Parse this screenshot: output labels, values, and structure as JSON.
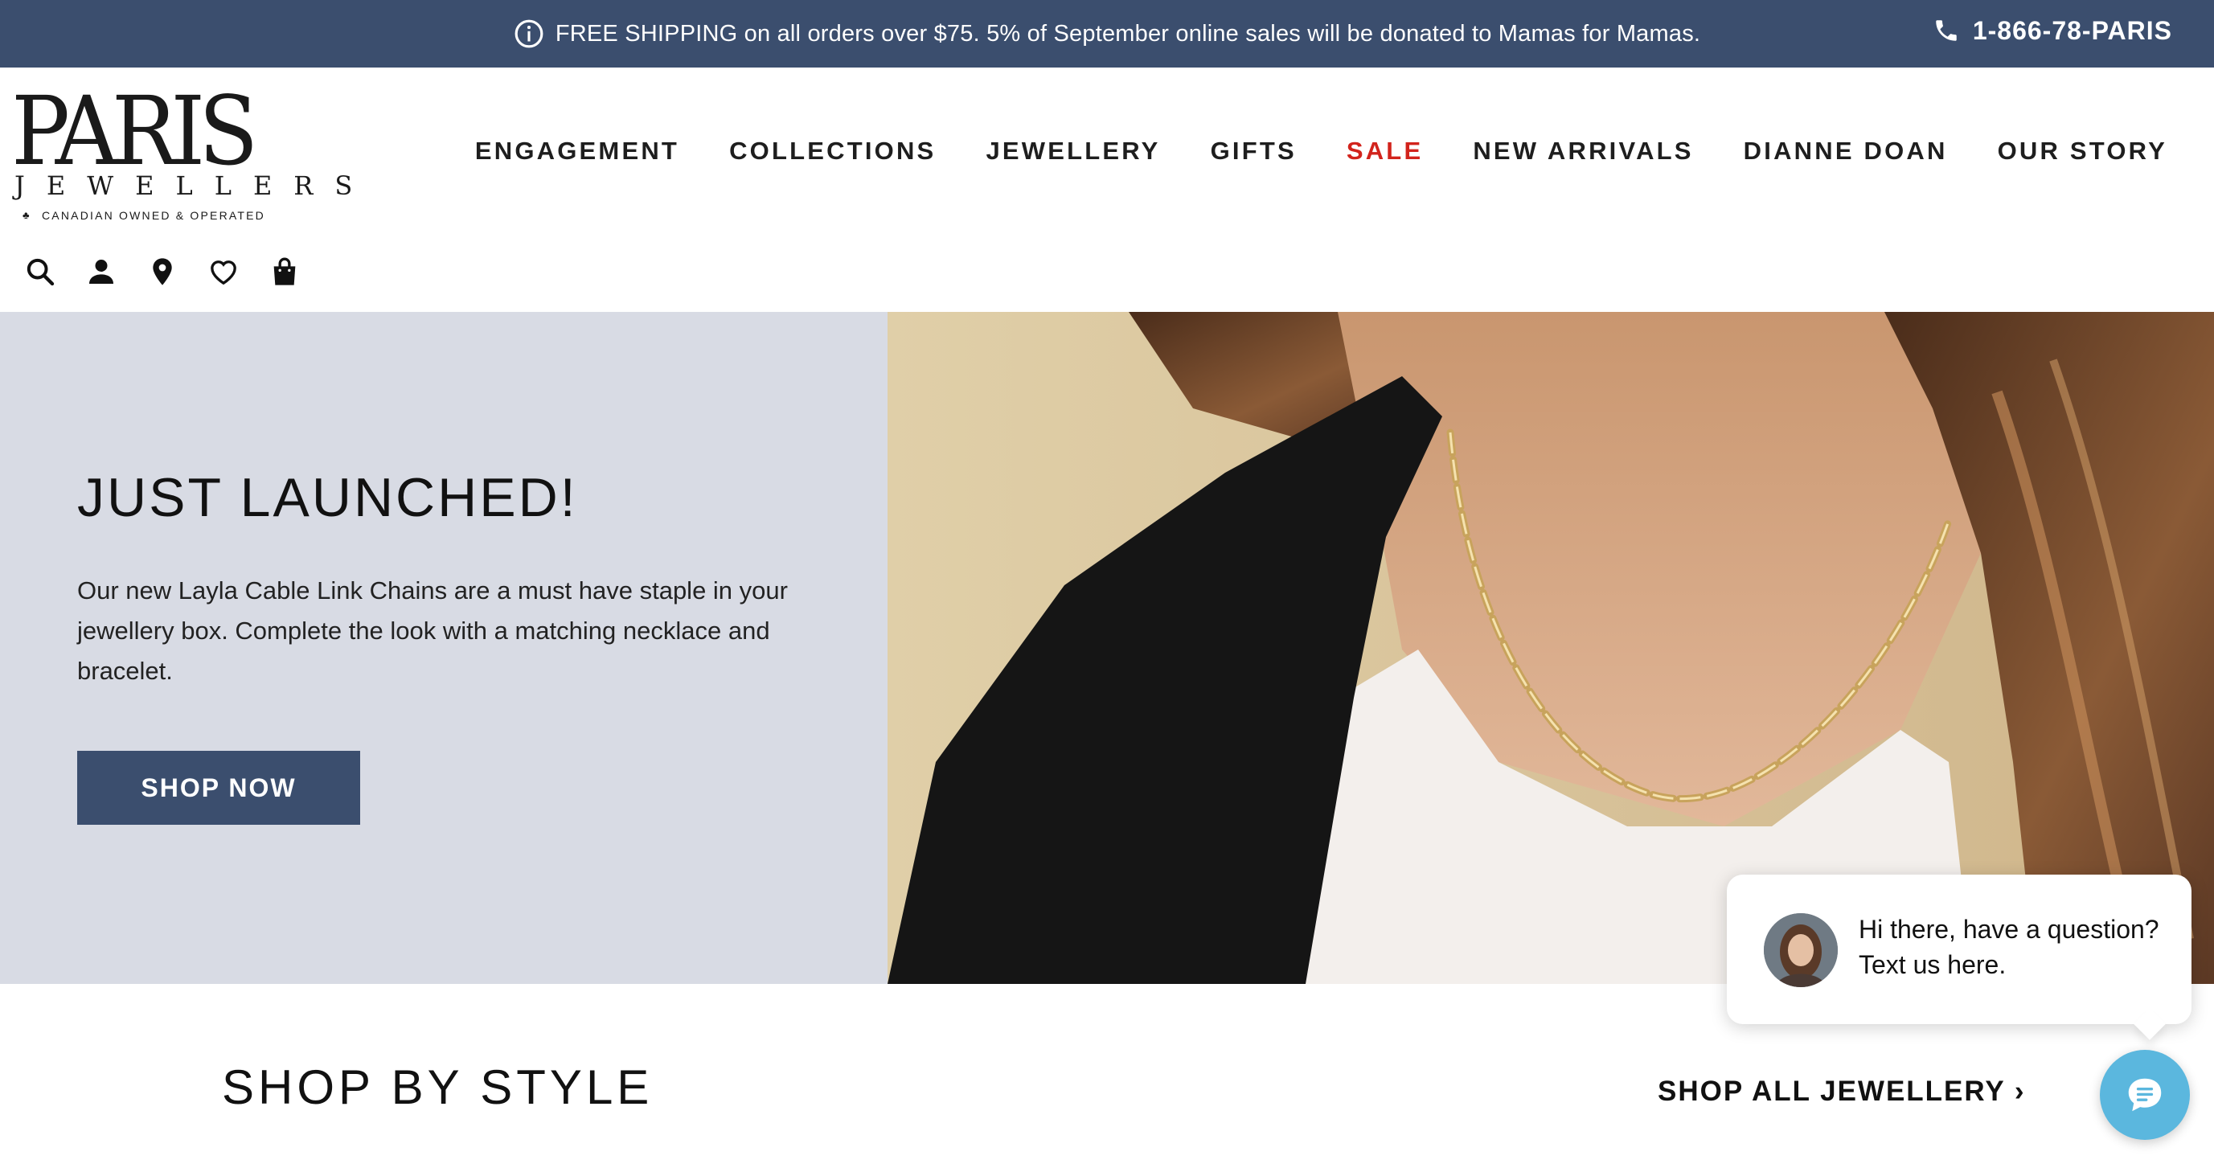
{
  "announcement": {
    "text": "FREE SHIPPING on all orders over $75. 5% of September online sales will be donated to Mamas for Mamas.",
    "icon": "info-circle-icon",
    "phone": "1-866-78-PARIS",
    "phone_icon": "phone-icon",
    "background": "#3b4e6e"
  },
  "logo": {
    "name": "PARIS",
    "subname": "JEWELLERS",
    "tagline": "CANADIAN OWNED & OPERATED"
  },
  "header_icons": [
    "search-icon",
    "account-icon",
    "store-locator-icon",
    "wishlist-heart-icon",
    "shopping-bag-icon"
  ],
  "nav": {
    "items": [
      {
        "label": "ENGAGEMENT"
      },
      {
        "label": "COLLECTIONS"
      },
      {
        "label": "JEWELLERY"
      },
      {
        "label": "GIFTS"
      },
      {
        "label": "SALE",
        "color": "#d2231c"
      },
      {
        "label": "NEW ARRIVALS"
      },
      {
        "label": "DIANNE DOAN"
      },
      {
        "label": "OUR STORY"
      }
    ]
  },
  "hero": {
    "title": "JUST LAUNCHED!",
    "text": "Our new Layla Cable Link Chains are a must have staple in your jewellery box. Complete the look with a matching necklace and bracelet.",
    "button": "SHOP NOW",
    "panel_color": "#d8dbe4"
  },
  "shop_by_style": {
    "title": "SHOP BY STYLE",
    "link": "SHOP ALL JEWELLERY ›"
  },
  "chat": {
    "message": "Hi there, have a question? Text us here.",
    "launcher_icon": "chat-bubble-icon",
    "launcher_color": "#5bb7de"
  }
}
